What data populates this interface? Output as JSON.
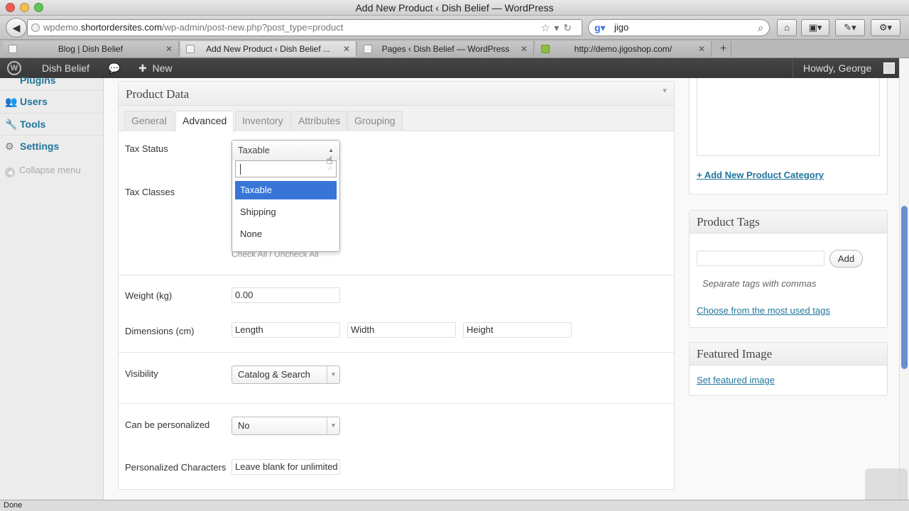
{
  "window": {
    "title": "Add New Product ‹ Dish Belief — WordPress"
  },
  "browser": {
    "url_prefix": "wpdemo.",
    "url_host": "shortordersites.com",
    "url_path": "/wp-admin/post-new.php?post_type=product",
    "search_value": "jigo",
    "tabs": [
      {
        "label": "Blog | Dish Belief"
      },
      {
        "label": "Add New Product ‹ Dish Belief ..."
      },
      {
        "label": "Pages ‹ Dish Belief — WordPress"
      },
      {
        "label": "http://demo.jigoshop.com/"
      }
    ]
  },
  "adminbar": {
    "site": "Dish Belief",
    "new": "New",
    "howdy": "Howdy, George"
  },
  "menu": {
    "items": [
      {
        "label": "Plugins"
      },
      {
        "label": "Users"
      },
      {
        "label": "Tools"
      },
      {
        "label": "Settings"
      }
    ],
    "collapse": "Collapse menu"
  },
  "product_data": {
    "title": "Product Data",
    "tabs": [
      "General",
      "Advanced",
      "Inventory",
      "Attributes",
      "Grouping"
    ],
    "tax_status_label": "Tax Status",
    "tax_status_value": "Taxable",
    "tax_options": [
      "Taxable",
      "Shipping",
      "None"
    ],
    "tax_classes_label": "Tax Classes",
    "check_all": "Check All / Uncheck All",
    "weight_label": "Weight (kg)",
    "weight_value": "0.00",
    "dimensions_label": "Dimensions (cm)",
    "length_placeholder": "Length",
    "width_placeholder": "Width",
    "height_placeholder": "Height",
    "visibility_label": "Visibility",
    "visibility_value": "Catalog & Search",
    "personalized_label": "Can be personalized",
    "personalized_value": "No",
    "chars_label": "Personalized Characters",
    "chars_placeholder": "Leave blank for unlimited"
  },
  "sidebar": {
    "add_category": "+ Add New Product Category",
    "tags_title": "Product Tags",
    "add_button": "Add",
    "tags_hint": "Separate tags with commas",
    "tags_choose": "Choose from the most used tags",
    "featured_title": "Featured Image",
    "featured_link": "Set featured image"
  },
  "status": {
    "text": "Done"
  },
  "colors": {
    "link": "#21759b",
    "highlight": "#3875d7",
    "adminbar": "#464646"
  }
}
